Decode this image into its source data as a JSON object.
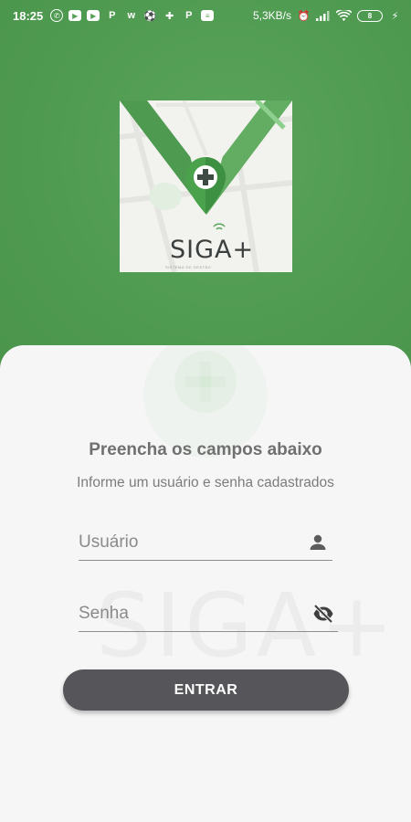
{
  "status_bar": {
    "time": "18:25",
    "net_speed": "5,3KB/s",
    "battery": "8",
    "left_icons": [
      "whatsapp-icon",
      "youtube-icon",
      "youtube-icon",
      "p-app-icon",
      "w-app-icon",
      "soccer-ball-icon",
      "game-controller-icon",
      "p-app-icon",
      "news-icon"
    ],
    "right_icons": [
      "alarm-icon",
      "signal-icon",
      "wifi-icon",
      "battery-icon",
      "charging-icon"
    ]
  },
  "logo": {
    "wordmark": "SIGA+",
    "tagline": "SISTEMA DE GESTÃO"
  },
  "form": {
    "title": "Preencha os campos abaixo",
    "subtitle": "Informe um usuário e senha cadastrados",
    "username": {
      "placeholder": "Usuário",
      "value": "",
      "icon": "person-icon"
    },
    "password": {
      "placeholder": "Senha",
      "value": "",
      "icon": "eye-off-icon"
    },
    "submit_label": "ENTRAR"
  },
  "colors": {
    "primary_green": "#58a059",
    "button_gray": "#55555a",
    "sheet_bg": "#f6f6f6"
  }
}
